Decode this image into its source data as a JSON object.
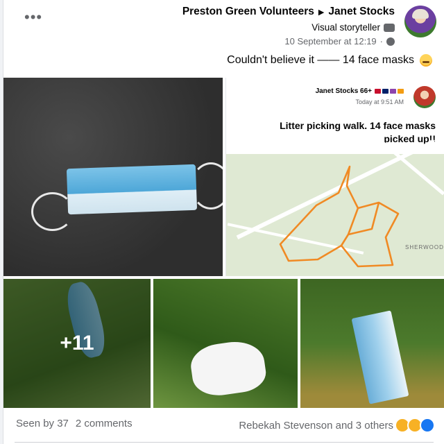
{
  "post": {
    "author": "Janet Stocks",
    "group": "Preston Green Volunteers",
    "badge": "Visual storyteller",
    "timestamp": "10 September at 12:19",
    "text": "Couldn't believe it —— 14 face masks",
    "emoji_icon": "grimacing-face-icon"
  },
  "shared_screenshot": {
    "name": "Janet Stocks 66+",
    "time": "Today at 9:51 AM",
    "text": "Litter picking walk. 14 face masks picked up!!",
    "map_labels": [
      "SHERWOOD"
    ]
  },
  "thumbnails": {
    "more_count": "+11"
  },
  "footer": {
    "reactions_text": "Rebekah Stevenson and 3 others",
    "comments": "2 comments",
    "seen_by": "Seen by 37",
    "reaction_icons": [
      "like-icon",
      "wow-icon",
      "sad-icon"
    ]
  },
  "colors": {
    "accent": "#1877f2",
    "secondary_text": "#65676b",
    "route": "#f08a24"
  }
}
